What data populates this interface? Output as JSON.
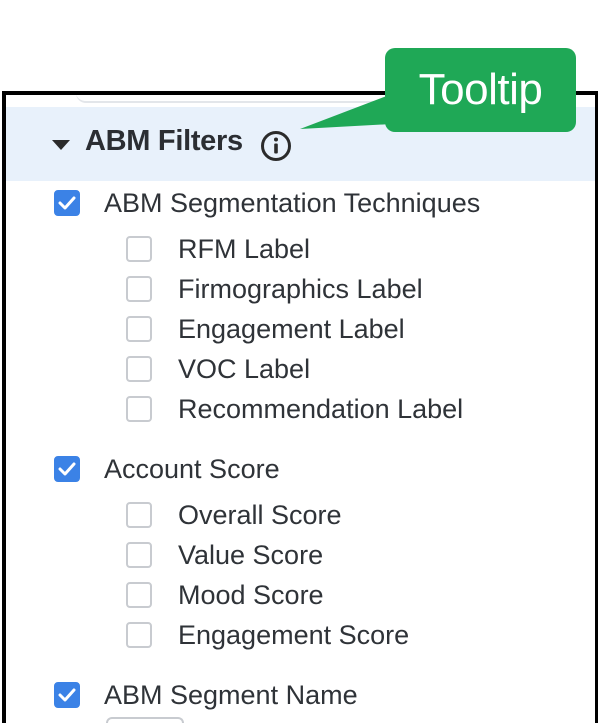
{
  "tooltip": {
    "text": "Tooltip"
  },
  "section": {
    "title": "ABM Filters",
    "expanded": true,
    "icons": {
      "toggle": "caret-down-icon",
      "info": "info-icon"
    }
  },
  "groups": [
    {
      "label": "ABM Segmentation Techniques",
      "checked": true,
      "items": [
        {
          "label": "RFM Label",
          "checked": false
        },
        {
          "label": "Firmographics Label",
          "checked": false
        },
        {
          "label": "Engagement Label",
          "checked": false
        },
        {
          "label": "VOC Label",
          "checked": false
        },
        {
          "label": "Recommendation Label",
          "checked": false
        }
      ]
    },
    {
      "label": "Account Score",
      "checked": true,
      "items": [
        {
          "label": "Overall Score",
          "checked": false
        },
        {
          "label": "Value Score",
          "checked": false
        },
        {
          "label": "Mood Score",
          "checked": false
        },
        {
          "label": "Engagement Score",
          "checked": false
        }
      ]
    },
    {
      "label": "ABM Segment Name",
      "checked": true,
      "items": []
    }
  ],
  "colors": {
    "tooltip_bg": "#1fa856",
    "header_bg": "#e8f1fb",
    "checkbox_checked": "#3b82e6"
  }
}
